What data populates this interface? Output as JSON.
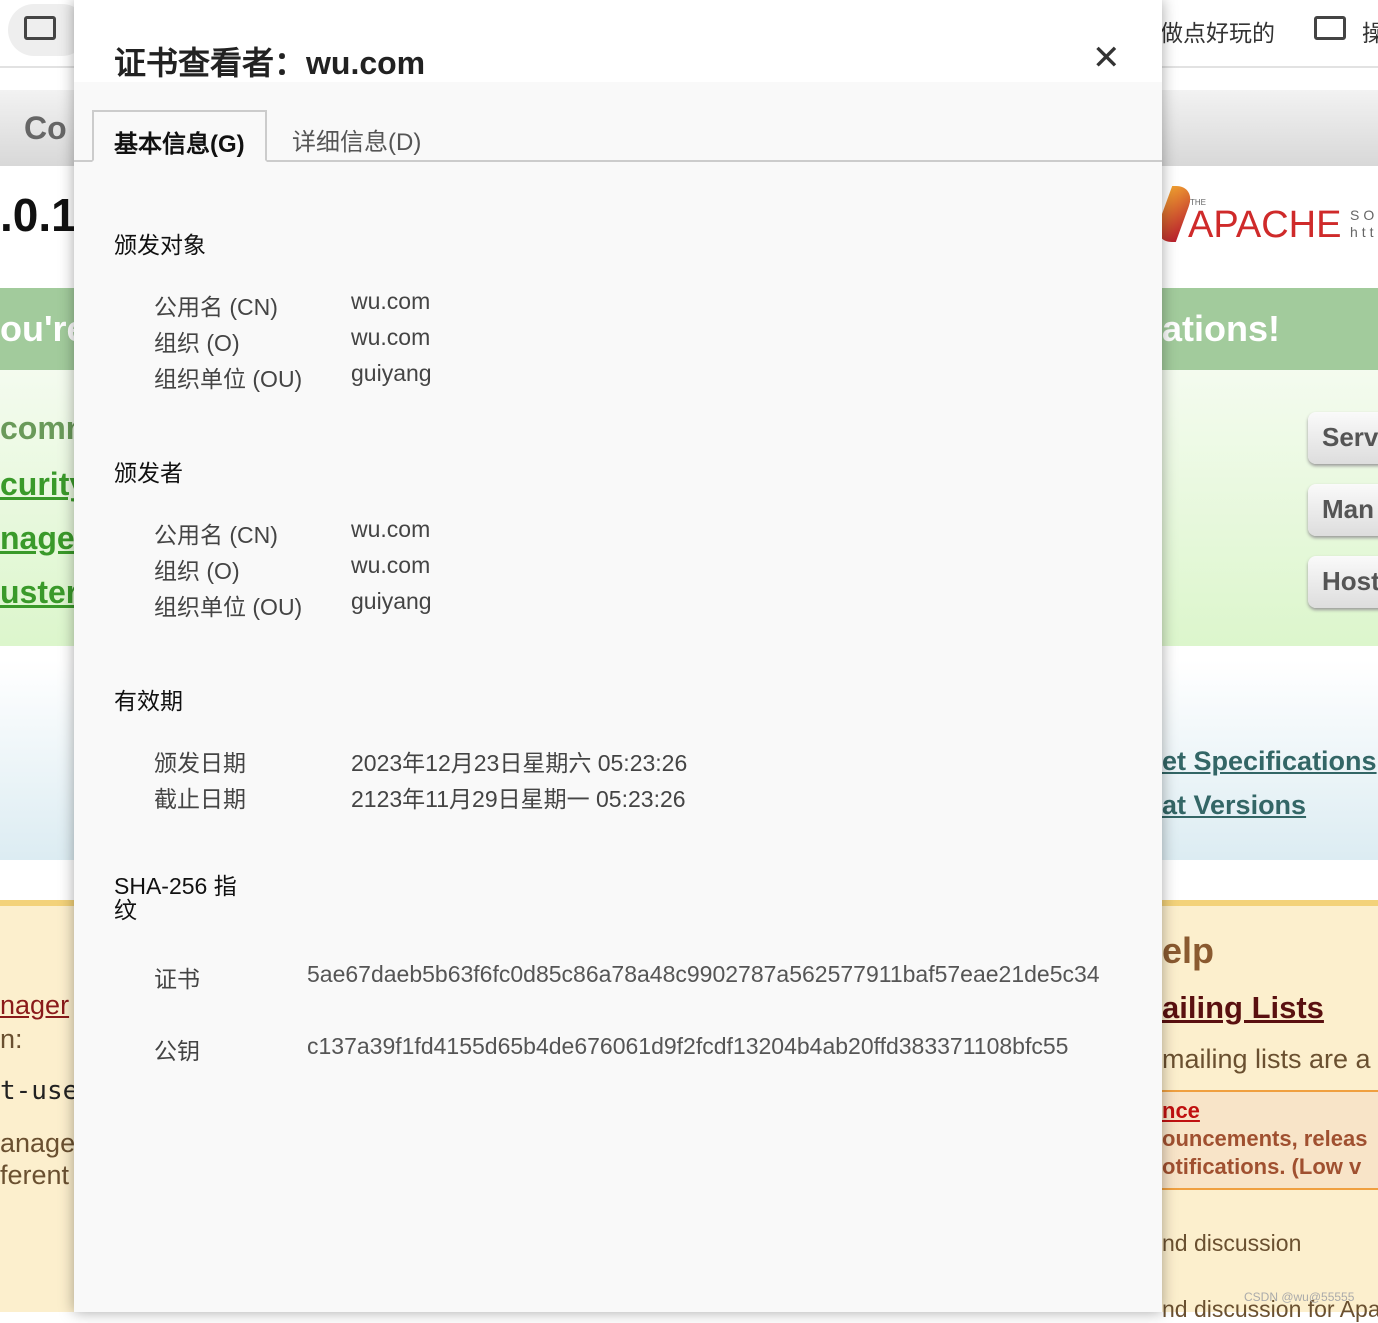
{
  "background": {
    "bookmark_right": "做点好玩的",
    "bookmark_right2": "操",
    "header_left": "Co",
    "version": ".0.1",
    "banner_left": "ou're",
    "banner_right": "ations!",
    "apache_the": "THE",
    "apache_name": "APACHE",
    "apache_sub1": "SO",
    "apache_sub2": "htt",
    "left_links": [
      "comm",
      "curity",
      "nage",
      "usteri"
    ],
    "right_buttons": [
      "Serv",
      "Man",
      "Host"
    ],
    "spec_links": [
      "et Specifications",
      "at Versions"
    ],
    "help_title": "elp",
    "mailing_lists": "ailing Lists",
    "mailing_text": "mailing lists are a",
    "announce_link": "nce",
    "announce_text1": "ouncements, releas",
    "announce_text2": "otifications. (Low v",
    "discussion1": "nd discussion",
    "discussion2": "nd discussion for Apa",
    "left_lower": [
      "nager",
      "n:",
      "t-user",
      "anage",
      "ferent"
    ],
    "watermark": "CSDN @wu@55555",
    "colors": {
      "green_band": "#a2cb9c",
      "green_link": "#3a9a2a",
      "help_bg": "#fcefcd",
      "apache_red": "#cf2a2a"
    }
  },
  "dialog": {
    "title": "证书查看者：wu.com",
    "close_icon": "close-icon",
    "tabs": [
      {
        "label": "基本信息(G)",
        "active": true
      },
      {
        "label": "详细信息(D)",
        "active": false
      }
    ],
    "subject": {
      "heading": "颁发对象",
      "rows": [
        {
          "label": "公用名 (CN)",
          "value": "wu.com"
        },
        {
          "label": "组织 (O)",
          "value": "wu.com"
        },
        {
          "label": "组织单位 (OU)",
          "value": "guiyang"
        }
      ]
    },
    "issuer": {
      "heading": "颁发者",
      "rows": [
        {
          "label": "公用名 (CN)",
          "value": "wu.com"
        },
        {
          "label": "组织 (O)",
          "value": "wu.com"
        },
        {
          "label": "组织单位 (OU)",
          "value": "guiyang"
        }
      ]
    },
    "validity": {
      "heading": "有效期",
      "rows": [
        {
          "label": "颁发日期",
          "value": "2023年12月23日星期六 05:23:26"
        },
        {
          "label": "截止日期",
          "value": "2123年11月29日星期一 05:23:26"
        }
      ]
    },
    "fingerprint": {
      "heading_line1": "SHA-256 指",
      "heading_line2": "纹",
      "rows": [
        {
          "label": "证书",
          "value": "5ae67daeb5b63f6fc0d85c86a78a48c9902787a562577911baf57eae21de5c34"
        },
        {
          "label": "公钥",
          "value": "c137a39f1fd4155d65b4de676061d9f2fcdf13204b4ab20ffd383371108bfc55"
        }
      ]
    }
  }
}
